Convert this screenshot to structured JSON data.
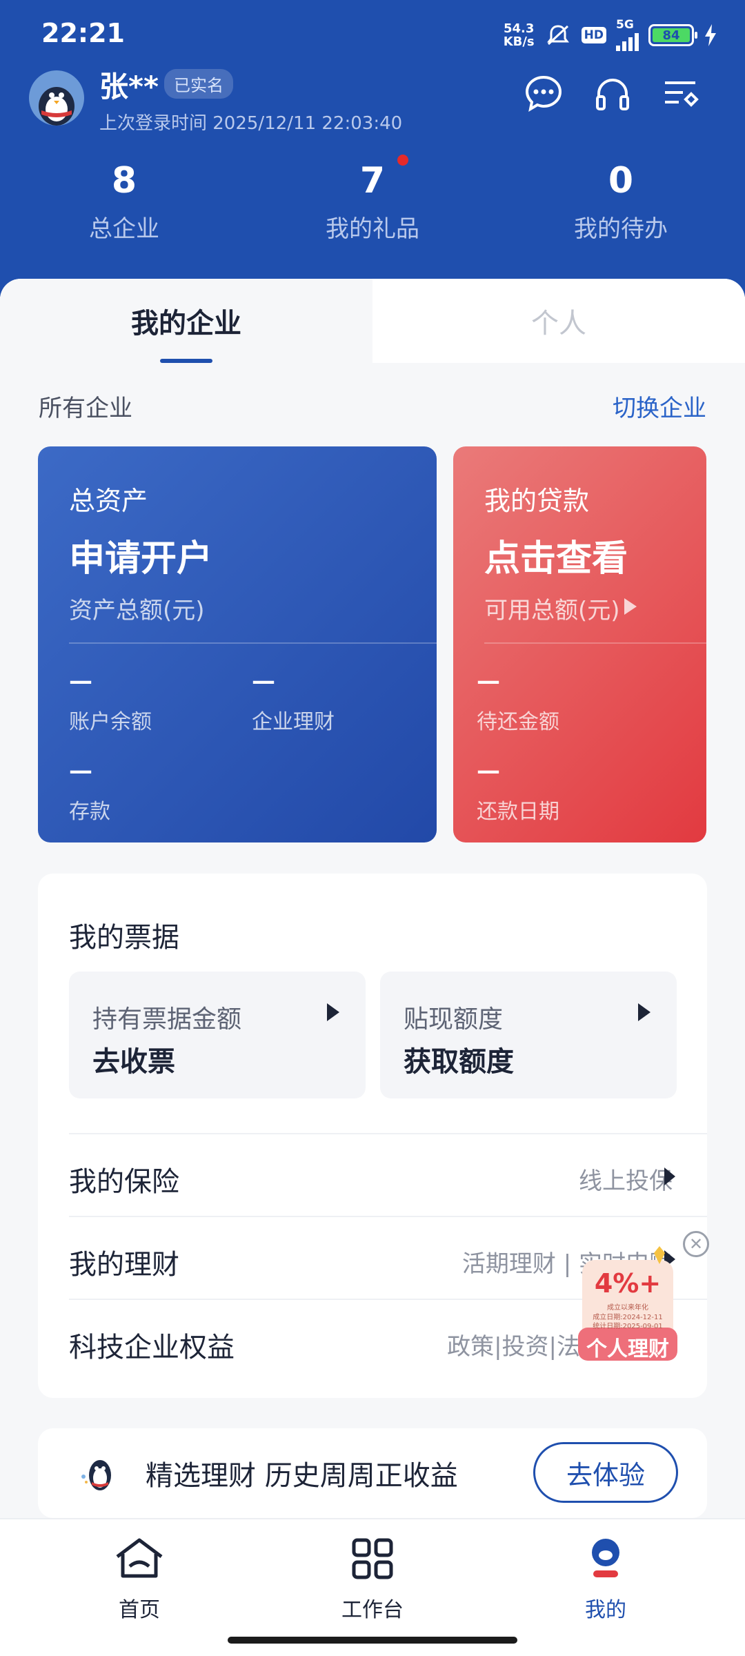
{
  "status_bar": {
    "time": "22:21",
    "net_speed_value": "54.3",
    "net_speed_unit": "KB/s",
    "hd_label": "HD",
    "network_label": "5G",
    "battery_level": "84",
    "icons": [
      "mute-icon",
      "hd-icon",
      "signal-5g-icon",
      "battery-icon",
      "charging-icon"
    ]
  },
  "header": {
    "user_name": "张**",
    "verified_label": "已实名",
    "last_login": "上次登录时间 2025/12/11 22:03:40",
    "icons": [
      "message-icon",
      "headset-icon",
      "settings-list-icon"
    ],
    "background_color": "#1f4fae"
  },
  "stats": [
    {
      "value": "8",
      "label": "总企业"
    },
    {
      "value": "7",
      "label": "我的礼品"
    },
    {
      "value": "0",
      "label": "我的待办"
    }
  ],
  "tabs": [
    {
      "label": "我的企业",
      "active": true
    },
    {
      "label": "个人",
      "active": false
    }
  ],
  "enterprise": {
    "all_label": "所有企业",
    "switch_label": "切换企业"
  },
  "asset_card": {
    "title": "总资产",
    "action": "申请开户",
    "subtitle": "资产总额(元)",
    "items": [
      {
        "value": "—",
        "label": "账户余额"
      },
      {
        "value": "—",
        "label": "企业理财"
      },
      {
        "value": "—",
        "label": "存款"
      }
    ],
    "color": "#2f5cb9"
  },
  "loan_card": {
    "title": "我的贷款",
    "action": "点击查看",
    "subtitle": "可用总额(元)",
    "items": [
      {
        "value": "—",
        "label": "待还金额"
      },
      {
        "value": "—",
        "label": "还款日期"
      }
    ],
    "color": "#e4474d"
  },
  "bills": {
    "title": "我的票据",
    "boxes": [
      {
        "label": "持有票据金额",
        "value": "去收票"
      },
      {
        "label": "贴现额度",
        "value": "获取额度"
      }
    ]
  },
  "list": [
    {
      "title": "我的保险",
      "right": "线上投保"
    },
    {
      "title": "我的理财",
      "right": "活期理财 | 实时申赎"
    },
    {
      "title": "科技企业权益",
      "right": "政策|投资|法律"
    }
  ],
  "promo_float": {
    "rate": "4%+",
    "line1": "成立以来年化",
    "line2": "成立日期:2024-12-11",
    "line3": "统计日期:2025-09-01",
    "tag": "个人理财"
  },
  "banner": {
    "text": "精选理财 历史周周正收益",
    "button": "去体验"
  },
  "bottom_nav": [
    {
      "label": "首页",
      "icon": "home-icon",
      "active": false
    },
    {
      "label": "工作台",
      "icon": "grid-icon",
      "active": false
    },
    {
      "label": "我的",
      "icon": "profile-icon",
      "active": true
    }
  ]
}
